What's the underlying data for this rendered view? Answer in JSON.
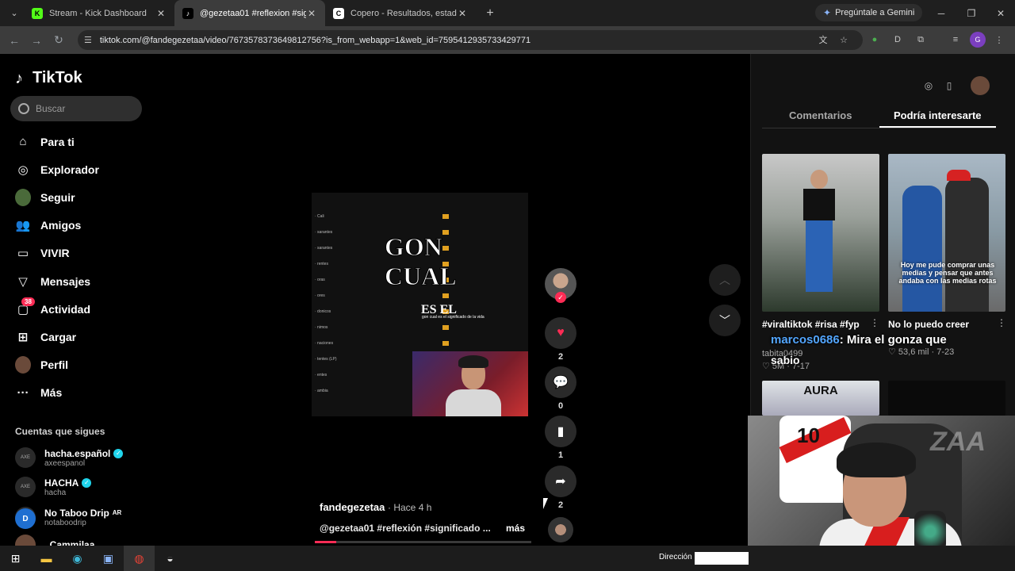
{
  "browser": {
    "tabs": [
      {
        "title": "Stream - Kick Dashboard",
        "icon": "kick-icon",
        "active": false
      },
      {
        "title": "@gezetaa01 #reflexion #signific",
        "icon": "tiktok-icon",
        "active": true
      },
      {
        "title": "Copero - Resultados, estadístic",
        "icon": "copero-icon",
        "active": false
      }
    ],
    "gemini_label": "Pregúntale a Gemini",
    "url": "tiktok.com/@fandegezetaa/video/7673578373649812756?is_from_webapp=1&web_id=7595412935733429771",
    "profile_initial": "G"
  },
  "sidebar": {
    "logo": "TikTok",
    "search_placeholder": "Buscar",
    "nav": [
      {
        "label": "Para ti",
        "icon": "home-icon"
      },
      {
        "label": "Explorador",
        "icon": "compass-icon"
      },
      {
        "label": "Seguir",
        "icon": "following-icon"
      },
      {
        "label": "Amigos",
        "icon": "friends-icon"
      },
      {
        "label": "VIVIR",
        "icon": "live-icon"
      },
      {
        "label": "Mensajes",
        "icon": "messages-icon"
      },
      {
        "label": "Actividad",
        "icon": "activity-icon",
        "badge": "38"
      },
      {
        "label": "Cargar",
        "icon": "upload-icon"
      },
      {
        "label": "Perfil",
        "icon": "profile-icon"
      },
      {
        "label": "Más",
        "icon": "more-icon"
      }
    ],
    "following_title": "Cuentas que sigues",
    "following": [
      {
        "name": "hacha.español",
        "handle": "axeespanol",
        "verified": true
      },
      {
        "name": "HACHA",
        "handle": "hacha",
        "verified": true
      },
      {
        "name": "No Taboo Drip",
        "handle": "notaboodrip",
        "verified": false,
        "tag": "AR"
      },
      {
        "name": "_Cammilaa",
        "handle": "",
        "verified": false
      }
    ]
  },
  "video": {
    "caption_main": "GON\nCUAL",
    "caption_es_el": "ES EL",
    "caption_small": "gon cual es el significado de la vida",
    "author": "fandegezetaa",
    "time": "Hace 4 h",
    "description": "@gezetaa01 #reflexión #significado ...",
    "more_label": "más",
    "progress": 0.1
  },
  "actions": {
    "likes": "2",
    "comments": "0",
    "saves": "1",
    "shares": "2"
  },
  "right_panel": {
    "tabs": [
      "Comentarios",
      "Podría interesarte"
    ],
    "active_tab": 1,
    "videos": [
      {
        "title": "#viraltiktok #risa #fyp",
        "author": "tabita0499",
        "likes": "5M",
        "date": "7-17"
      },
      {
        "title": "No lo puedo creer",
        "author": "",
        "likes": "53,6 mil",
        "date": "7-23",
        "overlay_text": "Hoy me pude comprar unas medias y pensar que antes andaba con las medias rotas"
      },
      {
        "title": "AURA"
      }
    ]
  },
  "stream_overlay": {
    "chat_user": "marcos0686",
    "chat_message": ": Mira el gonza que",
    "chat_message2": "sabio",
    "webcam_brand": "ZAA",
    "jersey_number": "10"
  },
  "taskbar": {
    "address_label": "Dirección"
  },
  "colors": {
    "accent": "#fe2c55",
    "verified": "#20d5ec",
    "browser_bg": "#1f1f1f"
  }
}
